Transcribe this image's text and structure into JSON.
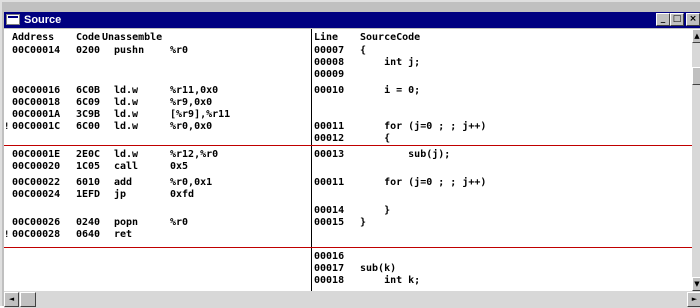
{
  "window": {
    "title": "Source"
  },
  "titlebar_buttons": {
    "minimize": "_",
    "maximize": "□",
    "close": "×"
  },
  "scroll": {
    "up": "▲",
    "down": "▼",
    "left": "◄",
    "right": "►"
  },
  "header": {
    "address": "Address",
    "code": "Code",
    "mnemonic": "Unassemble",
    "line": "Line",
    "source": "SourceCode"
  },
  "rows": [
    {
      "address": "00C00014",
      "code": "0200",
      "mnemonic": "pushn",
      "operand": "%r0",
      "line": "00007",
      "source": "{"
    },
    {
      "address": "",
      "code": "",
      "mnemonic": "",
      "operand": "",
      "line": "00008",
      "source": "    int j;"
    },
    {
      "address": "",
      "code": "",
      "mnemonic": "",
      "operand": "",
      "line": "00009",
      "source": ""
    },
    {
      "address": "00C00016",
      "code": "6C0B",
      "mnemonic": "ld.w",
      "operand": "%r11,0x0",
      "line": "00010",
      "source": "    i = 0;"
    },
    {
      "address": "00C00018",
      "code": "6C09",
      "mnemonic": "ld.w",
      "operand": "%r9,0x0",
      "line": "",
      "source": ""
    },
    {
      "address": "00C0001A",
      "code": "3C9B",
      "mnemonic": "ld.w",
      "operand": "[%r9],%r11",
      "line": "",
      "source": ""
    },
    {
      "address": "00C0001C",
      "code": "6C00",
      "mnemonic": "ld.w",
      "operand": "%r0,0x0",
      "line": "00011",
      "source": "    for (j=0 ; ; j++)",
      "marker": "!"
    },
    {
      "address": "",
      "code": "",
      "mnemonic": "",
      "operand": "",
      "line": "00012",
      "source": "    {"
    },
    {
      "address": "00C0001E",
      "code": "2E0C",
      "mnemonic": "ld.w",
      "operand": "%r12,%r0",
      "line": "00013",
      "source": "        sub(j);"
    },
    {
      "address": "00C00020",
      "code": "1C05",
      "mnemonic": "call",
      "operand": "0x5",
      "line": "",
      "source": ""
    },
    {
      "address": "00C00022",
      "code": "6010",
      "mnemonic": "add",
      "operand": "%r0,0x1",
      "line": "00011",
      "source": "    for (j=0 ; ; j++)"
    },
    {
      "address": "00C00024",
      "code": "1EFD",
      "mnemonic": "jp",
      "operand": "0xfd",
      "line": "",
      "source": ""
    },
    {
      "address": "",
      "code": "",
      "mnemonic": "",
      "operand": "",
      "line": "00014",
      "source": "    }"
    },
    {
      "address": "00C00026",
      "code": "0240",
      "mnemonic": "popn",
      "operand": "%r0",
      "line": "00015",
      "source": "}"
    },
    {
      "address": "00C00028",
      "code": "0640",
      "mnemonic": "ret",
      "operand": "",
      "line": "",
      "source": "",
      "marker": "!"
    },
    {
      "address": "",
      "code": "",
      "mnemonic": "",
      "operand": "",
      "line": "00016",
      "source": ""
    },
    {
      "address": "",
      "code": "",
      "mnemonic": "",
      "operand": "",
      "line": "00017",
      "source": "sub(k)"
    },
    {
      "address": "",
      "code": "",
      "mnemonic": "",
      "operand": "",
      "line": "00018",
      "source": "    int k;"
    }
  ]
}
